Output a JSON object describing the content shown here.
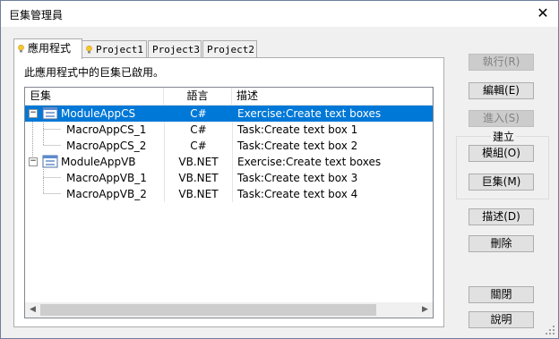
{
  "window": {
    "title": "巨集管理員"
  },
  "tabs": [
    {
      "label": "應用程式"
    },
    {
      "label": "Project1"
    },
    {
      "label": "Project3"
    },
    {
      "label": "Project2"
    }
  ],
  "panel": {
    "message": "此應用程式中的巨集已啟用。"
  },
  "list": {
    "columns": {
      "macro": "巨集",
      "language": "語言",
      "description": "描述"
    },
    "rows": [
      {
        "name": "ModuleAppCS",
        "language": "C#",
        "description": "Exercise:Create text boxes",
        "level": 0,
        "selected": true
      },
      {
        "name": "MacroAppCS_1",
        "language": "C#",
        "description": "Task:Create text box 1",
        "level": 1
      },
      {
        "name": "MacroAppCS_2",
        "language": "C#",
        "description": "Task:Create text box 2",
        "level": 1
      },
      {
        "name": "ModuleAppVB",
        "language": "VB.NET",
        "description": "Exercise:Create text boxes",
        "level": 0
      },
      {
        "name": "MacroAppVB_1",
        "language": "VB.NET",
        "description": "Task:Create text box 3",
        "level": 1
      },
      {
        "name": "MacroAppVB_2",
        "language": "VB.NET",
        "description": "Task:Create text box 4",
        "level": 1
      }
    ]
  },
  "buttons": {
    "run": "執行(R)",
    "edit": "編輯(E)",
    "step_into": "進入(S)",
    "create_group": "建立",
    "module": "模組(O)",
    "macro": "巨集(M)",
    "description": "描述(D)",
    "delete": "刪除",
    "close": "關閉",
    "help": "說明"
  },
  "colors": {
    "selection": "#0078d7",
    "accent": "#0078d7"
  }
}
